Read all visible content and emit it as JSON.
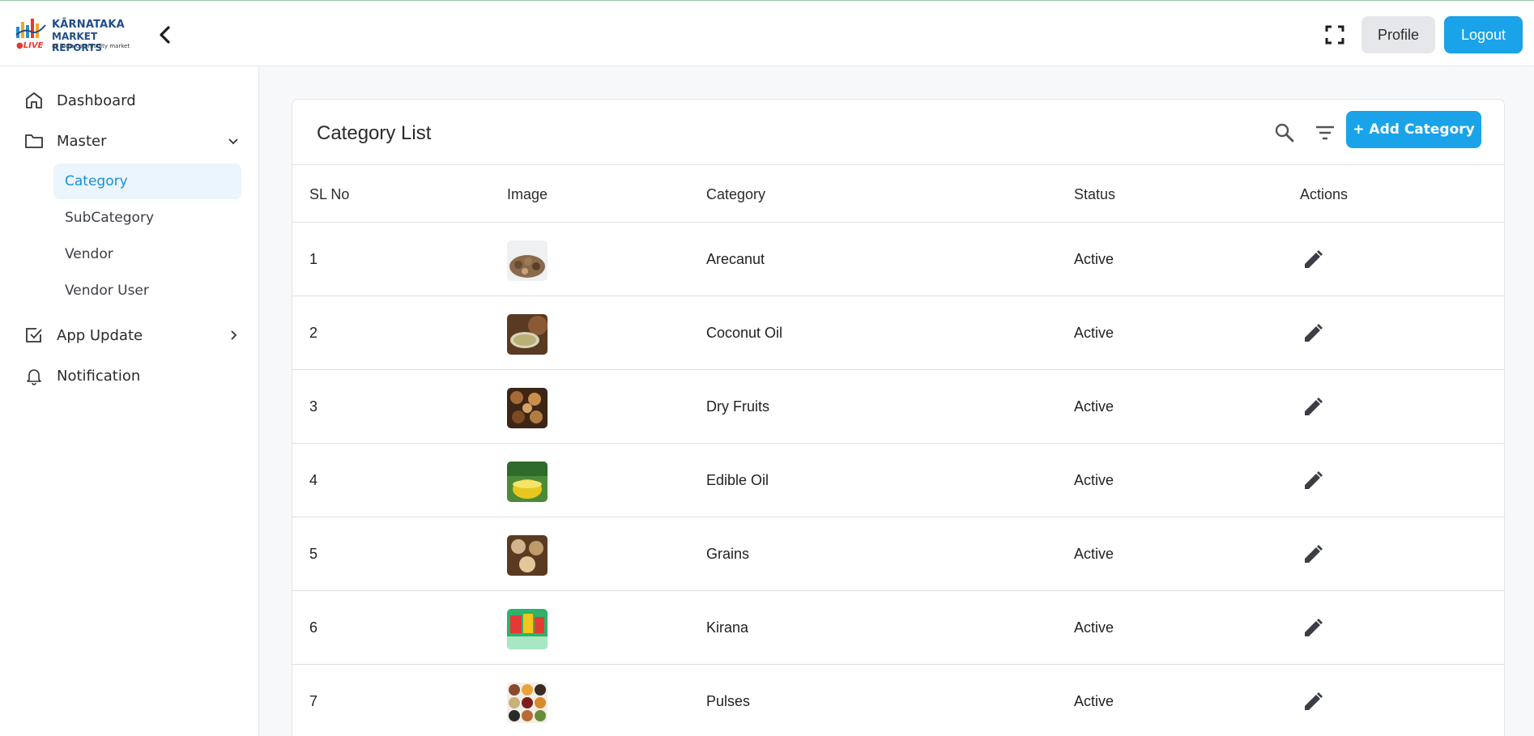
{
  "header": {
    "logo_line1": "KĀRNATAKA",
    "logo_line2": "MARKET REPORTS",
    "logo_line3": "all india commodity market",
    "logo_live": "●LIVE",
    "profile_label": "Profile",
    "logout_label": "Logout"
  },
  "sidebar": {
    "items": [
      {
        "label": "Dashboard",
        "icon": "home-icon"
      },
      {
        "label": "Master",
        "icon": "folder-icon",
        "expanded": true
      },
      {
        "label": "App Update",
        "icon": "checkbox-icon",
        "expanded": false
      },
      {
        "label": "Notification",
        "icon": "bell-icon"
      }
    ],
    "master_sub": [
      {
        "label": "Category",
        "active": true
      },
      {
        "label": "SubCategory"
      },
      {
        "label": "Vendor"
      },
      {
        "label": "Vendor User"
      }
    ]
  },
  "main": {
    "title": "Category List",
    "add_label": "+ Add Category",
    "columns": [
      "SL No",
      "Image",
      "Category",
      "Status",
      "Actions"
    ],
    "rows": [
      {
        "sl": "1",
        "category": "Arecanut",
        "status": "Active"
      },
      {
        "sl": "2",
        "category": "Coconut Oil",
        "status": "Active"
      },
      {
        "sl": "3",
        "category": "Dry Fruits",
        "status": "Active"
      },
      {
        "sl": "4",
        "category": "Edible Oil",
        "status": "Active"
      },
      {
        "sl": "5",
        "category": "Grains",
        "status": "Active"
      },
      {
        "sl": "6",
        "category": "Kirana",
        "status": "Active"
      },
      {
        "sl": "7",
        "category": "Pulses",
        "status": "Active"
      }
    ]
  },
  "colors": {
    "accent": "#1aa3e8",
    "active_bg": "#eaf5fd",
    "active_text": "#1a8fd4"
  }
}
